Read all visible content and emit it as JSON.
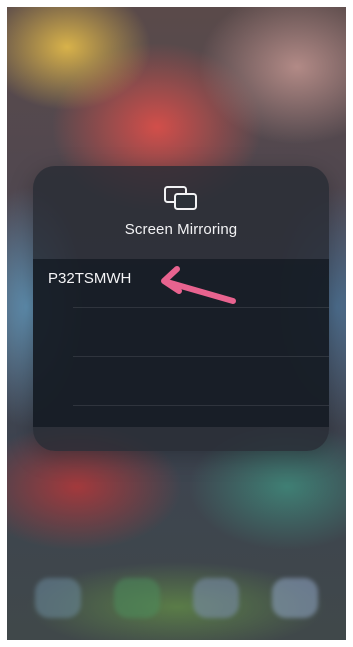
{
  "screen_mirroring": {
    "title": "Screen Mirroring",
    "icon": "screen-mirroring-icon",
    "devices": [
      {
        "label": "P32TSMWH"
      },
      {
        "label": ""
      },
      {
        "label": ""
      }
    ]
  },
  "annotation": {
    "icon": "arrow-icon",
    "color": "#e8638f"
  },
  "colors": {
    "panel": "#282c34",
    "list": "#101820",
    "text": "#f2f2f4"
  }
}
